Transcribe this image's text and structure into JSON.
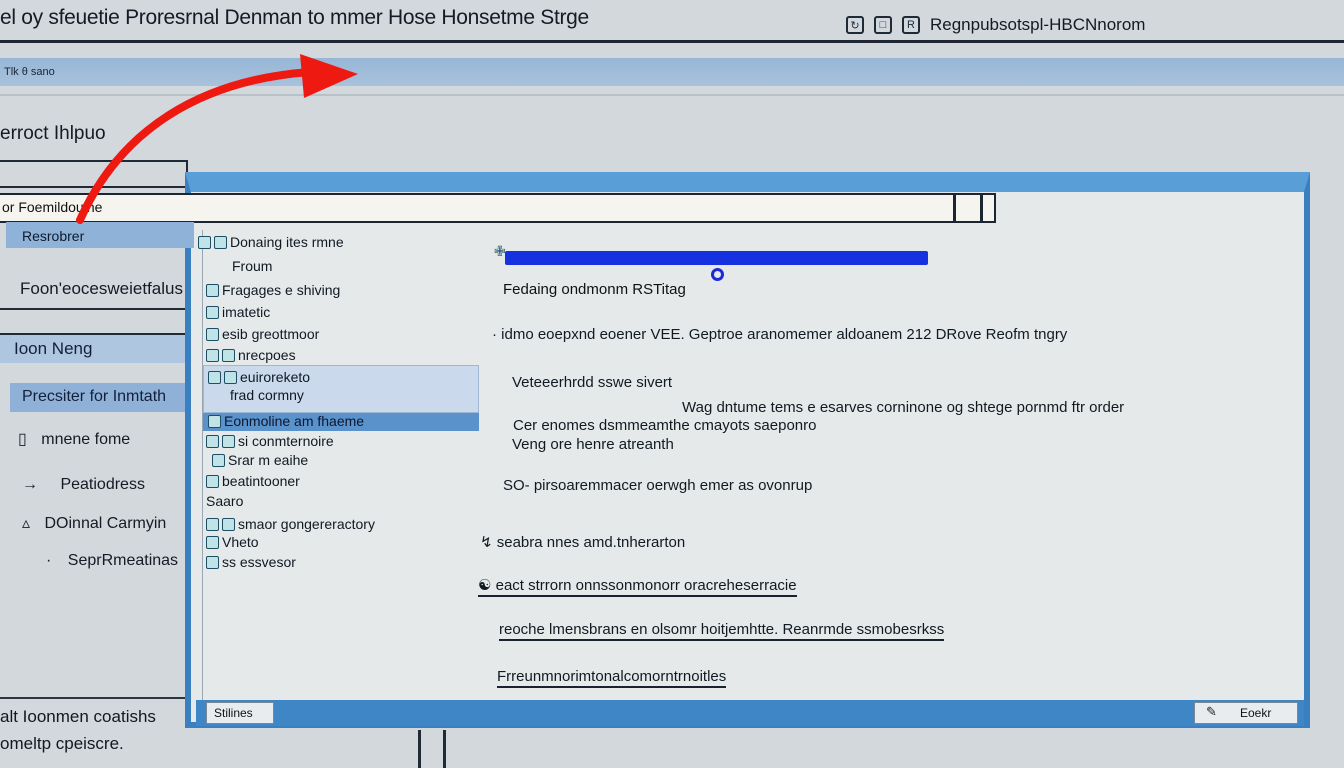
{
  "window": {
    "title": "el oy sfeuetie Proresrnal Denman to mmer Hose Honsetme Strge",
    "right_label": "Regnpubsotspl-HBCNnorom",
    "band_label": "Tlk θ sano",
    "section_title": "erroct Ihlpuo"
  },
  "url_bar": {
    "text": "or Foemildouine"
  },
  "left_panel": {
    "field_label": "Foon'eocesweietfalus",
    "login_label": "Ioon Neng",
    "selected_label": "Precsiter for Inmtath",
    "items": [
      {
        "icon": "▯",
        "label": "mnene fome"
      },
      {
        "icon": "→",
        "label": "Peatiodress"
      },
      {
        "icon": "▵",
        "label": "DOinnal Carmyin"
      },
      {
        "icon": "·",
        "label": "SeprRmeatinas"
      }
    ],
    "footer_note_1": "alt Ioonmen coatishs",
    "footer_note_2": "omeltp cpeiscre."
  },
  "dialog": {
    "sidebar_tab": "Resrobrer",
    "tree": [
      "Donaing ites rmne",
      "Froum",
      "Fragages e shiving",
      "imatetic",
      "esib greottmoor",
      "nrecpoes",
      "euiroreketo",
      "frad cormny",
      "Eonmoline am fhaeme",
      "si conmternoire",
      "Srar m eaihe",
      "beatintooner",
      "Saaro",
      "smaor gongereractory",
      "Vheto",
      "ss essvesor"
    ],
    "progress": {
      "value": 0.92,
      "label": "Fedaing ondmonm RSTitag"
    },
    "body": [
      "· idmo eoepxnd eoener VEE. Geptroe aranomemer aldoanem 212 DRove Reofm tngry",
      "Veteeerhrdd sswe sivert",
      "Wag dntume tems e esarves corninone og shtege pornmd ftr order",
      "Cer enomes dsmmeamthe cmayots saeponro",
      "Veng ore henre atreanth",
      "SO- pirsoaremmacer oerwgh emer as ovonrup",
      "seabra nnes amd.tnherarton",
      "eact strrorn onnssonmonorr oracreheserracie",
      "reoche lmensbrans en olsomr hoitjemhtte. Reanrmde ssmobesrkss",
      "Frreunmnorimtonalcomorntrnoitles"
    ],
    "status_button": "Stilines",
    "ok_button": "Eoekr"
  }
}
